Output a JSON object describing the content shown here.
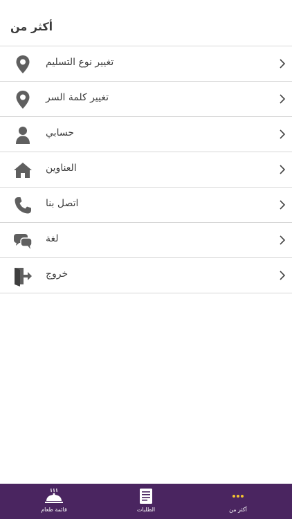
{
  "header": {
    "title": "أكثر من"
  },
  "menu": {
    "items": [
      {
        "label": "تغيير نوع التسليم",
        "icon": "location-pin-icon"
      },
      {
        "label": "تغيير كلمة السر",
        "icon": "location-pin-icon"
      },
      {
        "label": "حسابي",
        "icon": "user-icon"
      },
      {
        "label": "العناوين",
        "icon": "home-icon"
      },
      {
        "label": "اتصل بنا",
        "icon": "phone-icon"
      },
      {
        "label": "لغة",
        "icon": "chat-bubbles-icon"
      },
      {
        "label": "خروج",
        "icon": "logout-icon"
      }
    ]
  },
  "tabbar": {
    "tabs": [
      {
        "label": "قائمة طعام",
        "icon": "food-cloche-icon"
      },
      {
        "label": "الطلبات",
        "icon": "orders-icon"
      },
      {
        "label": "أكثر من",
        "icon": "more-dots-icon",
        "active": true
      }
    ]
  },
  "colors": {
    "tabbar_bg": "#4a2560",
    "accent": "#f4c430",
    "icon_gray": "#5f5f5f",
    "divider": "#d6d6d6"
  }
}
